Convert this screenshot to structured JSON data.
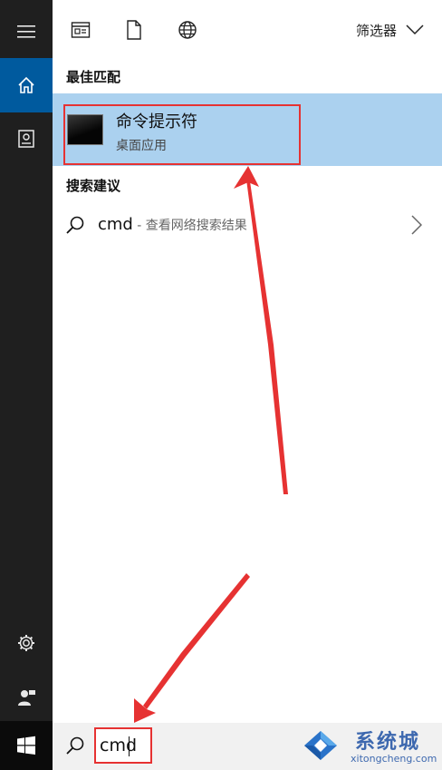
{
  "toolbar": {
    "filter_label": "筛选器"
  },
  "best_match": {
    "heading": "最佳匹配",
    "app_name": "命令提示符",
    "app_type": "桌面应用"
  },
  "suggestions": {
    "heading": "搜索建议",
    "items": [
      {
        "query": "cmd",
        "subtitle": " - 查看网络搜索结果"
      }
    ]
  },
  "search": {
    "value": "cmd"
  },
  "watermark": {
    "title": "系统城",
    "url": "xitongcheng.com"
  },
  "icons": {
    "rail": [
      "hamburger-icon",
      "home-icon",
      "notebook-icon",
      "gear-icon",
      "feedback-icon",
      "windows-logo-icon"
    ],
    "toolbar": [
      "apps-icon",
      "document-icon",
      "globe-icon",
      "chevron-down-icon"
    ],
    "search": "search-icon",
    "suggestion_arrow": "chevron-right-icon"
  },
  "colors": {
    "rail_bg": "#1f1f1f",
    "rail_active": "#005a9e",
    "best_match_bg": "#abd1ef",
    "annotation_red": "#e63232",
    "watermark_blue": "#2a5aa8"
  }
}
